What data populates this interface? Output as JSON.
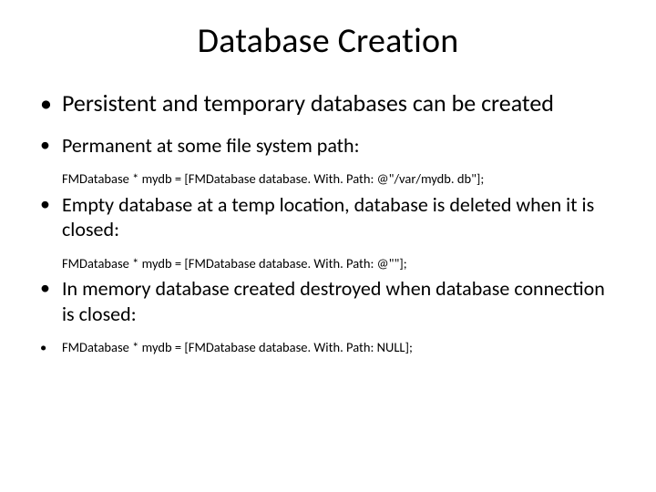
{
  "title": "Database Creation",
  "bullets": {
    "b1": "Persistent and temporary databases can be created",
    "b2": "Permanent at some file system path:",
    "c2": "FMDatabase * mydb = [FMDatabase database. With. Path: @\"/var/mydb. db\"];",
    "b3": "Empty database at a temp location, database is deleted when it is closed:",
    "c3": "FMDatabase * mydb = [FMDatabase database. With. Path: @\"\"];",
    "b4": "In memory database created destroyed when database connection is closed:",
    "c4": "FMDatabase * mydb = [FMDatabase database. With. Path: NULL];"
  }
}
